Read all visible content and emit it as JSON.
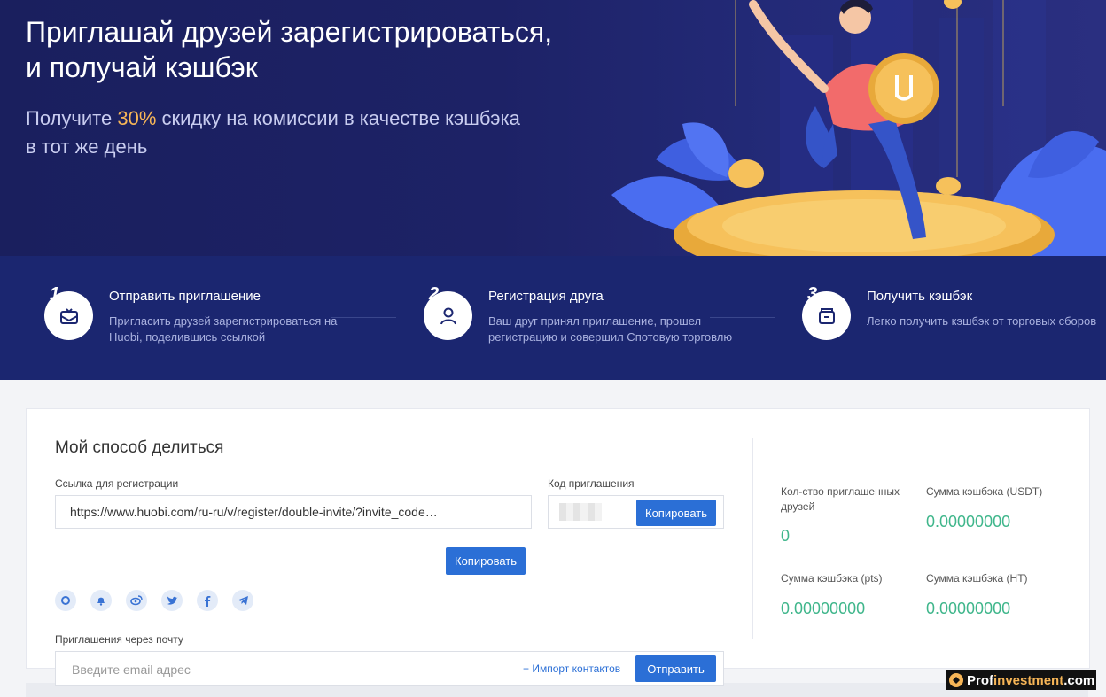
{
  "hero": {
    "title_line1": "Приглашай друзей зарегистрироваться,",
    "title_line2": "и получай кэшбэк",
    "sub_prefix": "Получите ",
    "sub_accent": "30%",
    "sub_line1_rest": " скидку на комиссии в качестве кэшбэка",
    "sub_line2": "в тот же день",
    "accent_color": "#f6b557"
  },
  "steps": [
    {
      "num": "1",
      "title": "Отправить приглашение",
      "desc": "Пригласить друзей зарегистрироваться на Huobi, поделившись ссылкой",
      "icon": "envelope-icon"
    },
    {
      "num": "2",
      "title": "Регистрация друга",
      "desc": "Ваш друг принял приглашение, прошел регистрацию и совершил Спотовую торговлю",
      "icon": "user-icon"
    },
    {
      "num": "3",
      "title": "Получить кэшбэк",
      "desc": "Легко получить кэшбэк от торговых сборов",
      "icon": "wallet-icon"
    }
  ],
  "share": {
    "title": "Мой способ делиться",
    "link_label": "Ссылка для регистрации",
    "link_value": "https://www.huobi.com/ru-ru/v/register/double-invite/?invite_code…",
    "code_label": "Код приглашения",
    "copy_code_button": "Копировать",
    "copy_link_button": "Копировать",
    "socials": [
      "qq-icon",
      "bell-icon",
      "weibo-icon",
      "twitter-icon",
      "facebook-icon",
      "telegram-icon"
    ],
    "email_label": "Приглашения через почту",
    "email_placeholder": "Введите email адрес",
    "import_contacts": "+ Импорт контактов",
    "send_button": "Отправить"
  },
  "stats": {
    "invited_label": "Кол-ство приглашенных друзей",
    "invited_value": "0",
    "usdt_label": "Сумма кэшбэка (USDT)",
    "usdt_value": "0.00000000",
    "pts_label": "Сумма кэшбэка (pts)",
    "pts_value": "0.00000000",
    "ht_label": "Сумма кэшбэка (HT)",
    "ht_value": "0.00000000"
  },
  "watermark": {
    "pre": "Prof",
    "accent": "investment",
    "post": ".com"
  },
  "colors": {
    "primary": "#2b6fd6",
    "success": "#3fb68b",
    "hero_bg": "#1d2266",
    "steps_bg": "#1b2670"
  }
}
